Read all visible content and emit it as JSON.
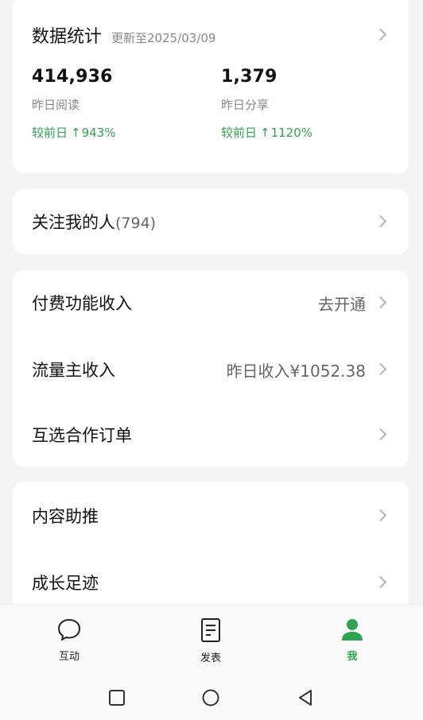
{
  "stats": {
    "title": "数据统计",
    "updated": "更新至2025/03/09",
    "items": [
      {
        "value": "414,936",
        "label": "昨日阅读",
        "change_prefix": "较前日",
        "change_arrow": "↑",
        "change_value": "943%"
      },
      {
        "value": "1,379",
        "label": "昨日分享",
        "change_prefix": "较前日",
        "change_arrow": "↑",
        "change_value": "1120%"
      }
    ]
  },
  "followers": {
    "label": "关注我的人",
    "count": "(794)"
  },
  "income": {
    "rows": [
      {
        "label": "付费功能收入",
        "value": "去开通"
      },
      {
        "label": "流量主收入",
        "value": "昨日收入¥1052.38"
      },
      {
        "label": "互选合作订单",
        "value": ""
      }
    ]
  },
  "tools": {
    "rows": [
      {
        "label": "内容助推"
      },
      {
        "label": "成长足迹"
      }
    ]
  },
  "nav": {
    "items": [
      {
        "label": "互动",
        "icon": "chat-bubble-icon"
      },
      {
        "label": "发表",
        "icon": "document-icon"
      },
      {
        "label": "我",
        "icon": "person-icon"
      }
    ],
    "active_color": "#2fa450"
  },
  "colors": {
    "accent": "#2fa450",
    "background": "#f3f4f3"
  }
}
